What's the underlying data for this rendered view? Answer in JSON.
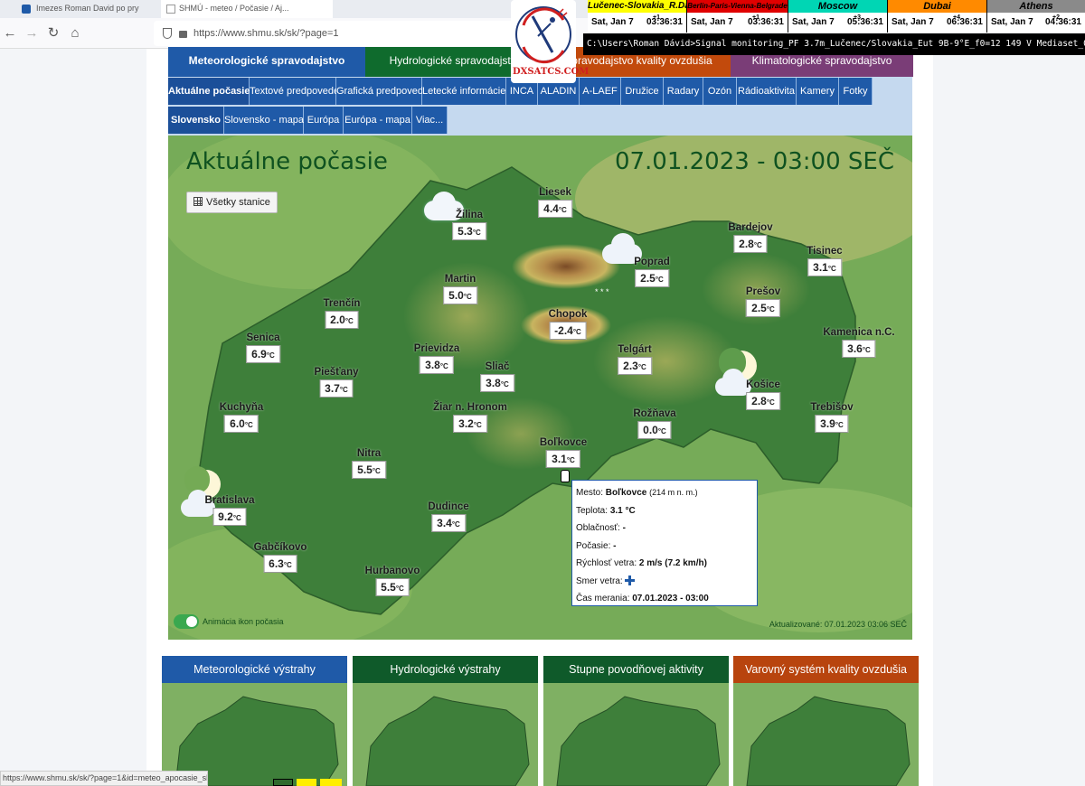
{
  "browser": {
    "tabs": [
      {
        "label": "Imezes Roman David po pry"
      },
      {
        "label": "SHMÚ - meteo / Počasie / Aj..."
      }
    ],
    "url": "https://www.shmu.sk/sk/?page=1",
    "status_url": "https://www.shmu.sk/sk/?page=1&id=meteo_apocasie_sk&ii=11927"
  },
  "overlay": {
    "clocks": [
      {
        "city": "Lučenec-Slovakia_R.Dávid",
        "date": "Sat, Jan 7",
        "offset": "+1",
        "time": "03:36:31",
        "color": "#ffff00",
        "text": "#000000"
      },
      {
        "city": "Berlin-Paris-Vienna-Belgrade",
        "date": "Sat, Jan 7",
        "offset": "+1",
        "time": "03:36:31",
        "color": "#e00000",
        "text": "#000000"
      },
      {
        "city": "Moscow",
        "date": "Sat, Jan 7",
        "offset": "+3",
        "time": "05:36:31",
        "color": "#00d6b4",
        "text": "#000000"
      },
      {
        "city": "Dubai",
        "date": "Sat, Jan 7",
        "offset": "+4",
        "time": "06:36:31",
        "color": "#ff8a00",
        "text": "#000000"
      },
      {
        "city": "Athens",
        "date": "Sat, Jan 7",
        "offset": "+2",
        "time": "04:36:31",
        "color": "#8a8a8a",
        "text": "#000000"
      }
    ],
    "command": "C:\\Users\\Roman Dávid>Signal monitoring_PF 3.7m_Lučenec/Slovakia_Eut 9B-9°E_f0=12 149 V Mediaset_01/2023",
    "logo_text": "DXSATCS.COM"
  },
  "nav": {
    "main_tabs": [
      {
        "label": "Meteorologické spravodajstvo",
        "color": "#1f5aa8"
      },
      {
        "label": "Hydrologické spravodajstvo",
        "color": "#0f6b2d"
      },
      {
        "label": "Spravodajstvo kvality ovzdušia",
        "color": "#c24a0c"
      },
      {
        "label": "Klimatologické spravodajstvo",
        "color": "#7a3d77"
      }
    ],
    "sub_tabs": [
      "Aktuálne počasie",
      "Textové predpovede",
      "Grafická predpoveď",
      "Letecké informácie",
      "INCA",
      "ALADIN",
      "A-LAEF",
      "Družice",
      "Radary",
      "Ozón",
      "Rádioaktivita",
      "Kamery",
      "Fotky"
    ],
    "region_tabs": [
      "Slovensko",
      "Slovensko - mapa",
      "Európa",
      "Európa - mapa",
      "Viac..."
    ]
  },
  "map": {
    "title": "Aktuálne počasie",
    "datetime": "07.01.2023 - 03:00 SEČ",
    "all_stations": "Všetky stanice",
    "unit": "°C",
    "stations": [
      {
        "name": "Liesek",
        "temp": "4.4"
      },
      {
        "name": "Žilina",
        "temp": "5.3"
      },
      {
        "name": "Poprad",
        "temp": "2.5"
      },
      {
        "name": "Bardejov",
        "temp": "2.8"
      },
      {
        "name": "Tisinec",
        "temp": "3.1"
      },
      {
        "name": "Martin",
        "temp": "5.0"
      },
      {
        "name": "Trenčín",
        "temp": "2.0"
      },
      {
        "name": "Prešov",
        "temp": "2.5"
      },
      {
        "name": "Chopok",
        "temp": "-2.4"
      },
      {
        "name": "Kamenica n.C.",
        "temp": "3.6"
      },
      {
        "name": "Senica",
        "temp": "6.9"
      },
      {
        "name": "Prievidza",
        "temp": "3.8"
      },
      {
        "name": "Telgárt",
        "temp": "2.3"
      },
      {
        "name": "Piešťany",
        "temp": "3.7"
      },
      {
        "name": "Sliač",
        "temp": "3.8"
      },
      {
        "name": "Košice",
        "temp": "2.8"
      },
      {
        "name": "Kuchyňa",
        "temp": "6.0"
      },
      {
        "name": "Žiar n. Hronom",
        "temp": "3.2"
      },
      {
        "name": "Rožňava",
        "temp": "0.0"
      },
      {
        "name": "Trebišov",
        "temp": "3.9"
      },
      {
        "name": "Nitra",
        "temp": "5.5"
      },
      {
        "name": "Boľkovce",
        "temp": "3.1"
      },
      {
        "name": "Bratislava",
        "temp": "9.2"
      },
      {
        "name": "Dudince",
        "temp": "3.4"
      },
      {
        "name": "Gabčíkovo",
        "temp": "6.3"
      },
      {
        "name": "Hurbanovo",
        "temp": "5.5"
      }
    ],
    "tooltip": {
      "city_label": "Mesto:",
      "city": "Boľkovce",
      "altitude": "(214 m n. m.)",
      "temp_label": "Teplota:",
      "temp": "3.1 °C",
      "cloud_label": "Oblačnosť:",
      "cloud": "-",
      "weather_label": "Počasie:",
      "weather": "-",
      "wind_label": "Rýchlosť vetra:",
      "wind": "2 m/s (7.2 km/h)",
      "dir_label": "Smer vetra:",
      "time_label": "Čas merania:",
      "time": "07.01.2023 - 03:00"
    },
    "animation_label": "Animácia ikon počasia",
    "updated": "Aktualizované: 07.01.2023 03:06 SEČ"
  },
  "cards": [
    {
      "title": "Meteorologické výstrahy",
      "color": "#1f5aa8"
    },
    {
      "title": "Hydrologické výstrahy",
      "color": "#0f5a2a"
    },
    {
      "title": "Stupne povodňovej aktivity",
      "color": "#0f5a2a"
    },
    {
      "title": "Varovný systém kvality ovzdušia",
      "color": "#b8440e"
    }
  ]
}
